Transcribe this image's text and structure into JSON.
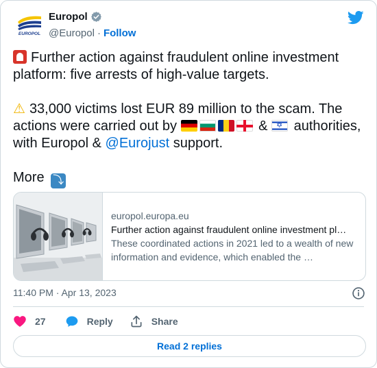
{
  "author": {
    "display_name": "Europol",
    "handle": "@Europol",
    "separator": "·",
    "follow_label": "Follow",
    "logo_label": "EUROPOL"
  },
  "tweet": {
    "line1": "Further action against fraudulent online investment platform: five arrests of high-value targets.",
    "line2_a": "33,000 victims lost EUR 89 million to the scam. The actions were carried out by",
    "line2_amp": "&",
    "line2_b": "authorities, with Europol &",
    "mention": "@Eurojust",
    "line2_c": "support.",
    "more": "More",
    "arrow_glyph": "⤵"
  },
  "link_card": {
    "domain": "europol.europa.eu",
    "title": "Further action against fraudulent online investment pl…",
    "description": "These coordinated actions in 2021 led to a wealth of new information and evidence, which enabled the …"
  },
  "meta": {
    "timestamp": "11:40 PM · Apr 13, 2023"
  },
  "actions": {
    "like_count": "27",
    "reply_label": "Reply",
    "share_label": "Share"
  },
  "read_replies_label": "Read 2 replies",
  "colors": {
    "link_blue": "#006fd6",
    "like_red": "#f91880",
    "reply_blue": "#1d9bf0",
    "border": "#cfd9de"
  }
}
